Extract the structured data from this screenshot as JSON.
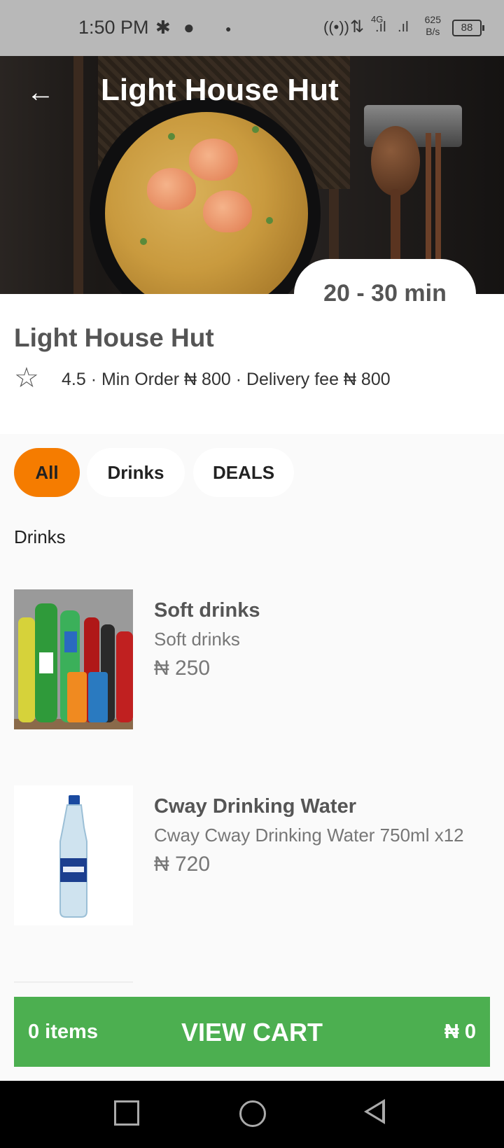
{
  "status_bar": {
    "time": "1:50 PM",
    "network": "4G",
    "speed_value": "625",
    "speed_unit": "B/s",
    "battery": "88"
  },
  "header": {
    "title": "Light House Hut",
    "back_icon": "arrow-left-icon"
  },
  "delivery_time": "20 - 30 min",
  "restaurant": {
    "name": "Light House Hut",
    "rating": "4.5",
    "meta_text": "4.5 · Min Order  ₦ 800 · Delivery fee  ₦ 800"
  },
  "filters": [
    {
      "label": "All",
      "active": true
    },
    {
      "label": "Drinks",
      "active": false
    },
    {
      "label": "DEALS",
      "active": false
    }
  ],
  "section_title": "Drinks",
  "items": [
    {
      "name": "Soft drinks",
      "description": "Soft drinks",
      "price": "₦ 250"
    },
    {
      "name": " Cway Drinking Water",
      "description": "Cway Cway Drinking Water 750ml x12",
      "price": "₦ 720"
    }
  ],
  "cart": {
    "count": "0 items",
    "action": "VIEW CART",
    "total": "₦ 0"
  },
  "colors": {
    "accent": "#f57c00",
    "cart_green": "#4caf50"
  }
}
